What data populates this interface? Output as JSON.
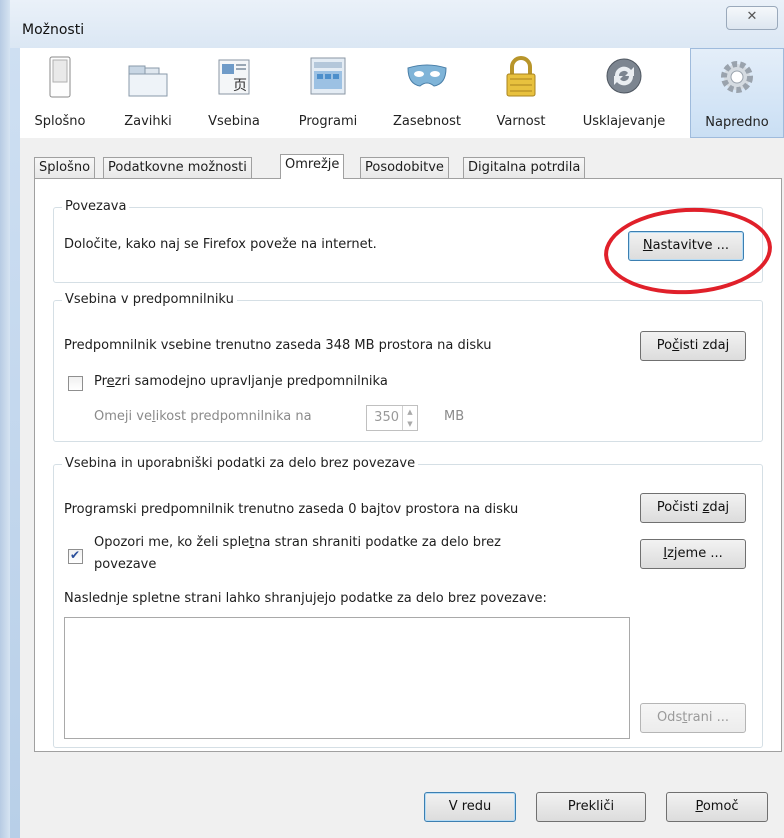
{
  "window": {
    "title": "Možnosti",
    "close_glyph": "✕"
  },
  "toolbar": {
    "items": [
      {
        "label": "Splošno",
        "icon": "switch-icon"
      },
      {
        "label": "Zavihki",
        "icon": "tabs-icon"
      },
      {
        "label": "Vsebina",
        "icon": "content-icon"
      },
      {
        "label": "Programi",
        "icon": "applications-icon"
      },
      {
        "label": "Zasebnost",
        "icon": "mask-icon"
      },
      {
        "label": "Varnost",
        "icon": "padlock-icon"
      },
      {
        "label": "Usklajevanje",
        "icon": "sync-icon"
      },
      {
        "label": "Napredno",
        "icon": "gear-icon",
        "selected": true
      }
    ]
  },
  "tabs": [
    "Splošno",
    "Podatkovne možnosti",
    "Omrežje",
    "Posodobitve",
    "Digitalna potrdila"
  ],
  "active_tab": "Omrežje",
  "connection": {
    "title": "Povezava",
    "text": "Določite, kako naj se Firefox poveže na internet.",
    "button_pre": "",
    "button_key": "N",
    "button_rest": "astavitve ..."
  },
  "cache": {
    "title": "Vsebina v predpomnilniku",
    "text": "Predpomnilnik vsebine trenutno zaseda 348 MB prostora na disku",
    "clear_pre": "Po",
    "clear_key": "č",
    "clear_rest": "isti zdaj",
    "override_pre": "Pr",
    "override_key": "e",
    "override_rest": "zri samodejno upravljanje predpomnilnika",
    "limit_pre": "Omeji ve",
    "limit_key": "l",
    "limit_rest": "ikost predpomnilnika na",
    "limit_value": "350",
    "limit_unit": "MB"
  },
  "offline": {
    "title": "Vsebina in uporabniški podatki za delo brez povezave",
    "text": "Programski predpomnilnik trenutno zaseda 0 bajtov prostora na disku",
    "clear_pre": "Počisti ",
    "clear_key": "z",
    "clear_rest": "daj",
    "warn_line1_pre": "Opozori me, ko želi sple",
    "warn_key": "t",
    "warn_line1_rest": "na stran shraniti podatke za delo brez",
    "warn_line2": "povezave",
    "exceptions_key": "I",
    "exceptions_rest": "zjeme ...",
    "list_label": "Naslednje spletne strani lahko shranjujejo podatke za delo brez povezave:",
    "remove_pre": "Ods",
    "remove_key": "t",
    "remove_rest": "rani ..."
  },
  "footer": {
    "ok": "V redu",
    "cancel": "Prekliči",
    "help_key": "P",
    "help_rest": "omoč"
  },
  "colors": {
    "highlight_ring": "#e0202a",
    "selected_tool": "#cadff4"
  }
}
